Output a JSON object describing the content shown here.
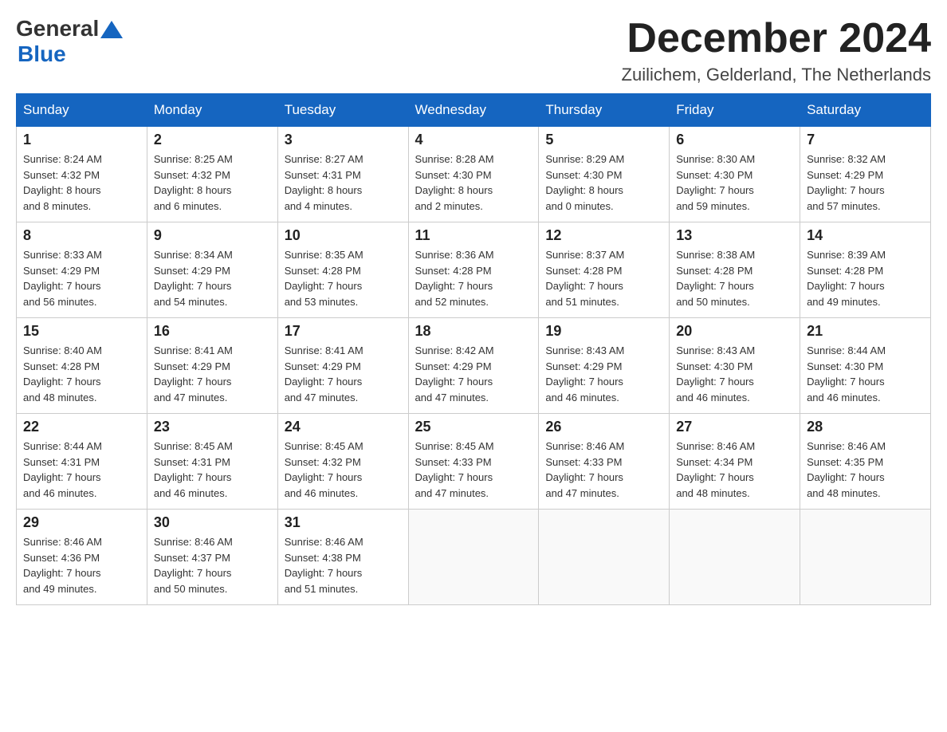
{
  "header": {
    "logo_general": "General",
    "logo_blue": "Blue",
    "month_title": "December 2024",
    "location": "Zuilichem, Gelderland, The Netherlands"
  },
  "days_of_week": [
    "Sunday",
    "Monday",
    "Tuesday",
    "Wednesday",
    "Thursday",
    "Friday",
    "Saturday"
  ],
  "weeks": [
    [
      {
        "day": "1",
        "sunrise": "8:24 AM",
        "sunset": "4:32 PM",
        "daylight": "8 hours and 8 minutes."
      },
      {
        "day": "2",
        "sunrise": "8:25 AM",
        "sunset": "4:32 PM",
        "daylight": "8 hours and 6 minutes."
      },
      {
        "day": "3",
        "sunrise": "8:27 AM",
        "sunset": "4:31 PM",
        "daylight": "8 hours and 4 minutes."
      },
      {
        "day": "4",
        "sunrise": "8:28 AM",
        "sunset": "4:30 PM",
        "daylight": "8 hours and 2 minutes."
      },
      {
        "day": "5",
        "sunrise": "8:29 AM",
        "sunset": "4:30 PM",
        "daylight": "8 hours and 0 minutes."
      },
      {
        "day": "6",
        "sunrise": "8:30 AM",
        "sunset": "4:30 PM",
        "daylight": "7 hours and 59 minutes."
      },
      {
        "day": "7",
        "sunrise": "8:32 AM",
        "sunset": "4:29 PM",
        "daylight": "7 hours and 57 minutes."
      }
    ],
    [
      {
        "day": "8",
        "sunrise": "8:33 AM",
        "sunset": "4:29 PM",
        "daylight": "7 hours and 56 minutes."
      },
      {
        "day": "9",
        "sunrise": "8:34 AM",
        "sunset": "4:29 PM",
        "daylight": "7 hours and 54 minutes."
      },
      {
        "day": "10",
        "sunrise": "8:35 AM",
        "sunset": "4:28 PM",
        "daylight": "7 hours and 53 minutes."
      },
      {
        "day": "11",
        "sunrise": "8:36 AM",
        "sunset": "4:28 PM",
        "daylight": "7 hours and 52 minutes."
      },
      {
        "day": "12",
        "sunrise": "8:37 AM",
        "sunset": "4:28 PM",
        "daylight": "7 hours and 51 minutes."
      },
      {
        "day": "13",
        "sunrise": "8:38 AM",
        "sunset": "4:28 PM",
        "daylight": "7 hours and 50 minutes."
      },
      {
        "day": "14",
        "sunrise": "8:39 AM",
        "sunset": "4:28 PM",
        "daylight": "7 hours and 49 minutes."
      }
    ],
    [
      {
        "day": "15",
        "sunrise": "8:40 AM",
        "sunset": "4:28 PM",
        "daylight": "7 hours and 48 minutes."
      },
      {
        "day": "16",
        "sunrise": "8:41 AM",
        "sunset": "4:29 PM",
        "daylight": "7 hours and 47 minutes."
      },
      {
        "day": "17",
        "sunrise": "8:41 AM",
        "sunset": "4:29 PM",
        "daylight": "7 hours and 47 minutes."
      },
      {
        "day": "18",
        "sunrise": "8:42 AM",
        "sunset": "4:29 PM",
        "daylight": "7 hours and 47 minutes."
      },
      {
        "day": "19",
        "sunrise": "8:43 AM",
        "sunset": "4:29 PM",
        "daylight": "7 hours and 46 minutes."
      },
      {
        "day": "20",
        "sunrise": "8:43 AM",
        "sunset": "4:30 PM",
        "daylight": "7 hours and 46 minutes."
      },
      {
        "day": "21",
        "sunrise": "8:44 AM",
        "sunset": "4:30 PM",
        "daylight": "7 hours and 46 minutes."
      }
    ],
    [
      {
        "day": "22",
        "sunrise": "8:44 AM",
        "sunset": "4:31 PM",
        "daylight": "7 hours and 46 minutes."
      },
      {
        "day": "23",
        "sunrise": "8:45 AM",
        "sunset": "4:31 PM",
        "daylight": "7 hours and 46 minutes."
      },
      {
        "day": "24",
        "sunrise": "8:45 AM",
        "sunset": "4:32 PM",
        "daylight": "7 hours and 46 minutes."
      },
      {
        "day": "25",
        "sunrise": "8:45 AM",
        "sunset": "4:33 PM",
        "daylight": "7 hours and 47 minutes."
      },
      {
        "day": "26",
        "sunrise": "8:46 AM",
        "sunset": "4:33 PM",
        "daylight": "7 hours and 47 minutes."
      },
      {
        "day": "27",
        "sunrise": "8:46 AM",
        "sunset": "4:34 PM",
        "daylight": "7 hours and 48 minutes."
      },
      {
        "day": "28",
        "sunrise": "8:46 AM",
        "sunset": "4:35 PM",
        "daylight": "7 hours and 48 minutes."
      }
    ],
    [
      {
        "day": "29",
        "sunrise": "8:46 AM",
        "sunset": "4:36 PM",
        "daylight": "7 hours and 49 minutes."
      },
      {
        "day": "30",
        "sunrise": "8:46 AM",
        "sunset": "4:37 PM",
        "daylight": "7 hours and 50 minutes."
      },
      {
        "day": "31",
        "sunrise": "8:46 AM",
        "sunset": "4:38 PM",
        "daylight": "7 hours and 51 minutes."
      },
      null,
      null,
      null,
      null
    ]
  ],
  "labels": {
    "sunrise": "Sunrise:",
    "sunset": "Sunset:",
    "daylight": "Daylight:"
  }
}
